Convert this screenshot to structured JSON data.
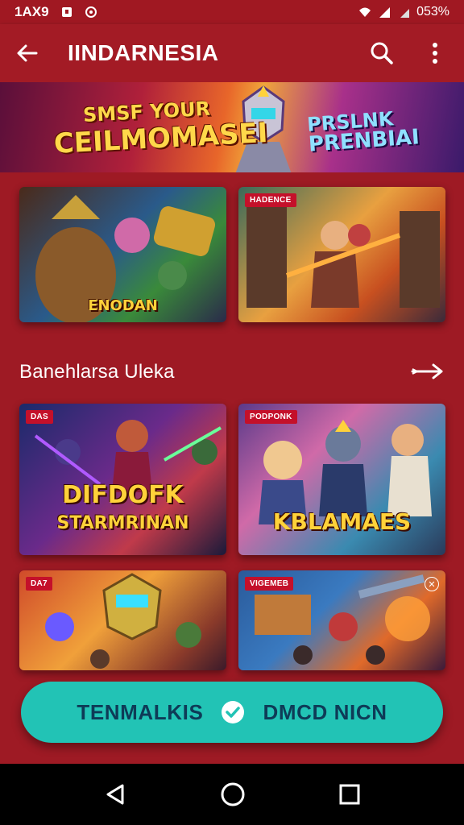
{
  "status_bar": {
    "time": "1AX9",
    "battery": "053%"
  },
  "app_bar": {
    "title": "IINDARNESIA"
  },
  "hero": {
    "left_line1": "SMSF YOUR",
    "left_line2": "CEILMOMASEI",
    "right_line1": "PRSLNK",
    "right_line2": "PRENBIAI"
  },
  "cards_top": [
    {
      "badge": "",
      "title": "ENODAN"
    },
    {
      "badge": "HADENCE",
      "title": ""
    }
  ],
  "section": {
    "title": "Banehlarsa Uleka"
  },
  "cards_mid": [
    {
      "badge": "DAS",
      "title_line1": "DIFDOFK",
      "title_line2": "STARMRINAN"
    },
    {
      "badge": "PODPONK",
      "title_line1": "KBLAMAES",
      "title_line2": ""
    }
  ],
  "cards_bottom": [
    {
      "badge": "DA7",
      "title": ""
    },
    {
      "badge": "VIGEMEB",
      "title": ""
    }
  ],
  "cta": {
    "label_left": "TENMALKIS",
    "label_right": "DMCD NICN"
  },
  "colors": {
    "background": "#9e1a24",
    "cta": "#22c3b5",
    "cta_text": "#0e3b57",
    "badge": "#c4102a"
  },
  "icons": [
    "back-arrow-icon",
    "search-icon",
    "more-vert-icon",
    "wifi-icon",
    "signal-icon",
    "check-circle-icon",
    "nav-back-icon",
    "nav-home-icon",
    "nav-recents-icon"
  ]
}
